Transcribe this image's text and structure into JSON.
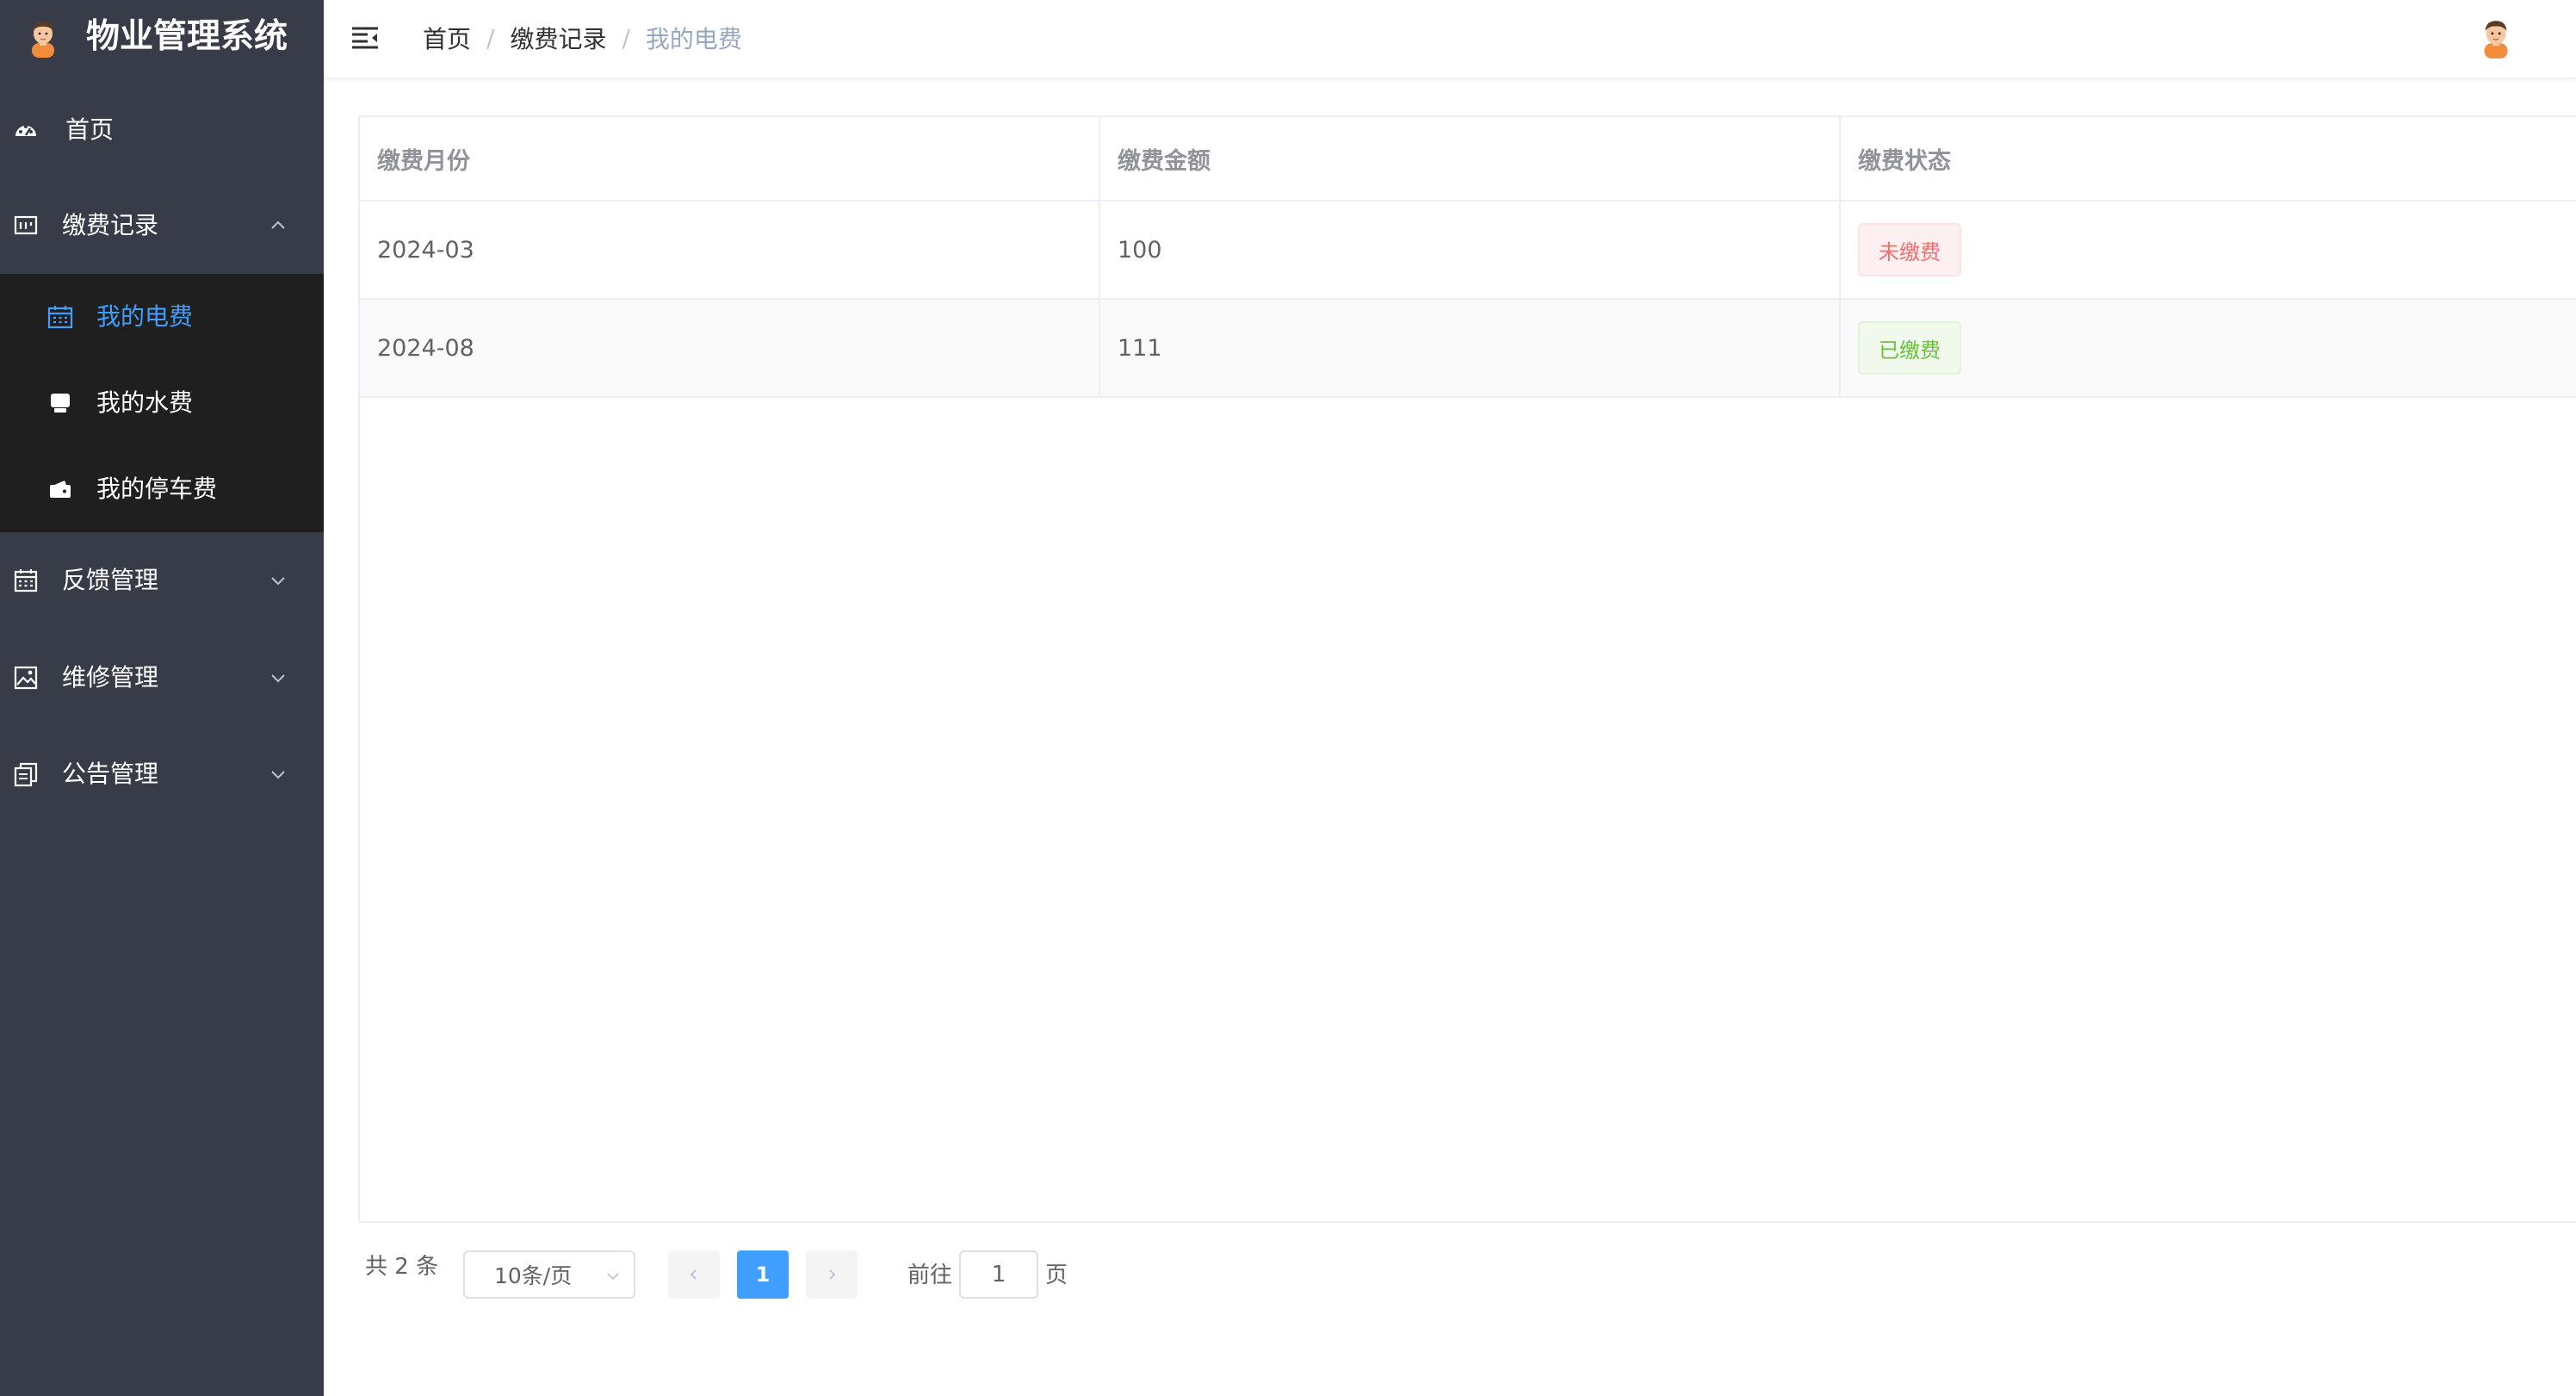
{
  "app": {
    "title": "物业管理系统",
    "colors": {
      "sidebar_bg": "#383c48",
      "submenu_bg": "#1f1f1f",
      "accent": "#409eff"
    }
  },
  "sidebar": {
    "home": {
      "label": "首页",
      "icon": "dashboard-icon"
    },
    "payment_records": {
      "label": "缴费记录",
      "icon": "data-board-icon",
      "expanded": true,
      "items": [
        {
          "label": "我的电费",
          "icon": "calendar-icon",
          "active": true
        },
        {
          "label": "我的水费",
          "icon": "monitor-icon",
          "active": false
        },
        {
          "label": "我的停车费",
          "icon": "wallet-icon",
          "active": false
        }
      ]
    },
    "feedback": {
      "label": "反馈管理",
      "icon": "calendar-icon"
    },
    "repair": {
      "label": "维修管理",
      "icon": "picture-icon"
    },
    "notice": {
      "label": "公告管理",
      "icon": "document-copy-icon"
    }
  },
  "header": {
    "breadcrumb": [
      "首页",
      "缴费记录",
      "我的电费"
    ],
    "separator": "/"
  },
  "table": {
    "columns": [
      "缴费月份",
      "缴费金额",
      "缴费状态"
    ],
    "rows": [
      {
        "month": "2024-03",
        "amount": "100",
        "status": "未缴费",
        "status_type": "danger"
      },
      {
        "month": "2024-08",
        "amount": "111",
        "status": "已缴费",
        "status_type": "success"
      }
    ]
  },
  "pagination": {
    "total_text": "共 2 条",
    "page_size": "10条/页",
    "current_page": "1",
    "goto_label": "前往",
    "goto_value": "1",
    "goto_suffix": "页"
  }
}
